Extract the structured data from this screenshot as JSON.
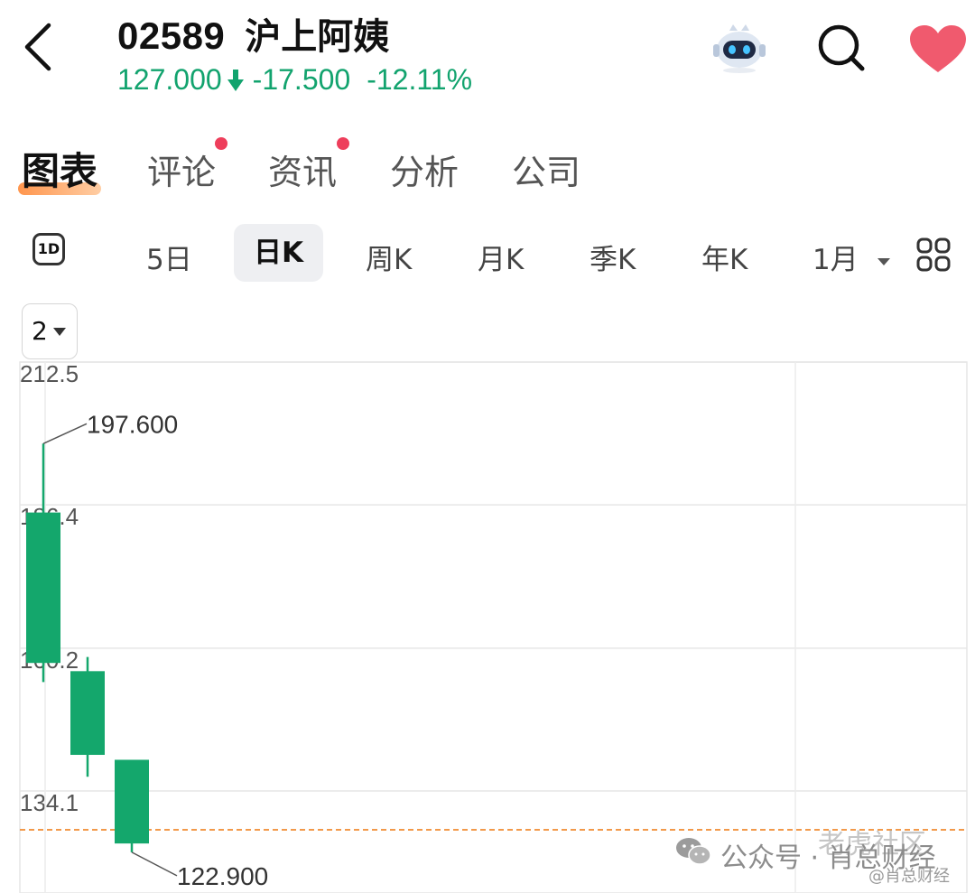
{
  "header": {
    "stock_code": "02589",
    "stock_name": "沪上阿姨",
    "price": "127.000",
    "change": "-17.500",
    "change_pct": "-12.11%",
    "direction_icon": "arrow-down-icon",
    "up_down_color": "#12a36e"
  },
  "top_icons": [
    "back-icon",
    "robot-assistant-icon",
    "search-icon",
    "heart-icon"
  ],
  "favorite_color": "#f05a6e",
  "tabs": [
    {
      "label": "图表",
      "active": true,
      "dot": false
    },
    {
      "label": "评论",
      "active": false,
      "dot": true
    },
    {
      "label": "资讯",
      "active": false,
      "dot": true
    },
    {
      "label": "分析",
      "active": false,
      "dot": false
    },
    {
      "label": "公司",
      "active": false,
      "dot": false
    }
  ],
  "periods": {
    "badge": "1D",
    "items": [
      "5日",
      "日K",
      "周K",
      "月K",
      "季K",
      "年K",
      "1月"
    ],
    "active": "日K",
    "more_icon": "grid-layout-icon"
  },
  "indicator_select": {
    "value": "2"
  },
  "chart_data": {
    "type": "candlestick",
    "y_tick_labels": [
      "212.5",
      "186.4",
      "160.2",
      "134.1"
    ],
    "ylim": [
      126.0,
      212.5
    ],
    "candles": [
      {
        "open": 185.0,
        "close": 157.5,
        "high": 197.6,
        "low": 154.0
      },
      {
        "open": 156.0,
        "close": 140.7,
        "high": 158.6,
        "low": 136.7
      },
      {
        "open": 139.8,
        "close": 124.5,
        "high": 139.8,
        "low": 122.9
      }
    ],
    "annotations": {
      "high_label": "197.600",
      "low_label": "122.900"
    },
    "last_price_line": 127.0,
    "candle_color": "#14a76c",
    "last_price_line_color": "#f2994a",
    "grid": true
  },
  "watermark": {
    "line1": "公众号 · 肖总财经",
    "line2": "@肖总财经",
    "overlay": "老虎社区"
  }
}
